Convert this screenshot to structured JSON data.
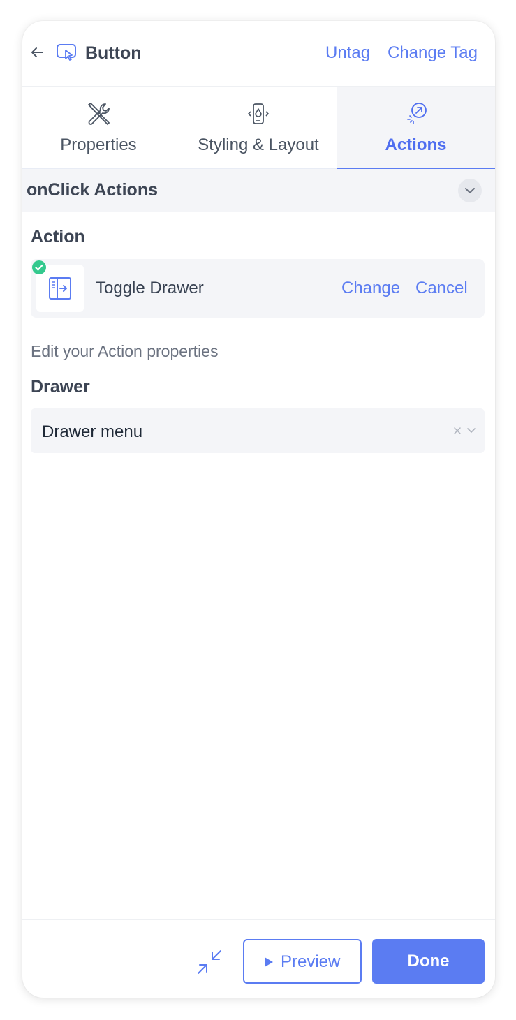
{
  "header": {
    "title": "Button",
    "untag_label": "Untag",
    "change_tag_label": "Change Tag",
    "back_icon": "arrow-left-icon",
    "tag_icon": "button-tap-icon"
  },
  "tabs": [
    {
      "label": "Properties",
      "icon": "wrench-screwdriver-icon",
      "active": false
    },
    {
      "label": "Styling & Layout",
      "icon": "mobile-style-icon",
      "active": false
    },
    {
      "label": "Actions",
      "icon": "cursor-click-icon",
      "active": true
    }
  ],
  "section": {
    "title": "onClick Actions",
    "collapse_icon": "chevron-down-icon"
  },
  "action": {
    "label": "Action",
    "name": "Toggle Drawer",
    "icon": "drawer-toggle-icon",
    "change_label": "Change",
    "cancel_label": "Cancel"
  },
  "edit_hint": "Edit your Action properties",
  "drawer_field": {
    "label": "Drawer",
    "value": "Drawer menu"
  },
  "footer": {
    "preview_label": "Preview",
    "done_label": "Done"
  },
  "colors": {
    "accent": "#5b7cf2",
    "success": "#34c98e",
    "section_bg": "#f4f5f8"
  }
}
